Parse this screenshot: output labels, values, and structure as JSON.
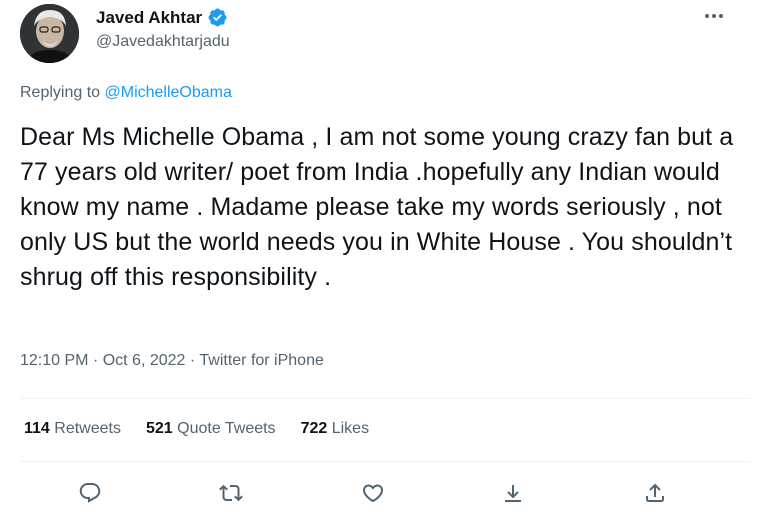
{
  "author": {
    "display_name": "Javed Akhtar",
    "handle": "@Javedakhtarjadu",
    "verified": true
  },
  "replying": {
    "prefix": "Replying to",
    "mention": "@MichelleObama"
  },
  "tweet": {
    "text": "Dear Ms Michelle Obama , I am not some young crazy fan but a 77 years old writer/ poet from India .hopefully any Indian would know my name . Madame please take my words seriously , not only US but the world needs you in White House . You shouldn’t shrug off this responsibility .",
    "time": "12:10 PM",
    "separator1": "·",
    "date": "Oct 6, 2022",
    "separator2": "·",
    "source": "Twitter for iPhone"
  },
  "stats": {
    "retweets_count": "114",
    "retweets_label": "Retweets",
    "quotes_count": "521",
    "quotes_label": "Quote Tweets",
    "likes_count": "722",
    "likes_label": "Likes"
  },
  "icons": {
    "verified": "verified-badge-icon",
    "more": "more-icon",
    "reply": "reply-icon",
    "retweet": "retweet-icon",
    "like": "heart-icon",
    "bookmark": "bookmark-icon",
    "share": "share-icon"
  },
  "colors": {
    "accent": "#1d9bf0",
    "secondary_text": "#536471",
    "primary_text": "#0f1419"
  }
}
